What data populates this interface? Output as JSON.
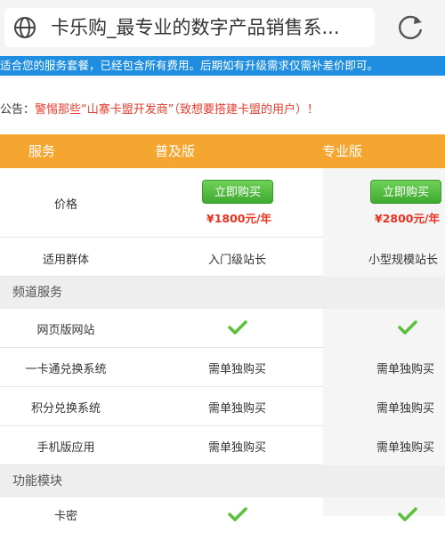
{
  "browser": {
    "url_title": "卡乐购_最专业的数字产品销售系...",
    "globe_icon": "globe-icon",
    "refresh_icon": "refresh-icon"
  },
  "notice": "适合您的服务套餐，已经包含所有费用。后期如有升级需求仅需补差价即可。",
  "announcement": {
    "label": "公告：",
    "message": "警惕那些“山寨卡盟开发商”（致想要搭建卡盟的用户）！"
  },
  "table": {
    "headers": [
      "服务",
      "普及版",
      "专业版"
    ],
    "price_row": {
      "label": "价格",
      "buy_label": "立即购买",
      "price_basic": "¥1800元/年",
      "price_pro": "¥2800元/年"
    },
    "audience_row": {
      "label": "适用群体",
      "basic": "入门级站长",
      "pro": "小型规模站长"
    },
    "sections": [
      {
        "title": "频道服务",
        "rows": [
          {
            "label": "网页版网站",
            "basic": "✔",
            "pro": "✔"
          },
          {
            "label": "一卡通兑换系统",
            "basic": "需单独购买",
            "pro": "需单独购买"
          },
          {
            "label": "积分兑换系统",
            "basic": "需单独购买",
            "pro": "需单独购买"
          },
          {
            "label": "手机版应用",
            "basic": "需单独购买",
            "pro": "需单独购买"
          }
        ]
      },
      {
        "title": "功能模块",
        "rows": [
          {
            "label": "卡密",
            "basic": "✔",
            "pro": "✔"
          }
        ]
      }
    ]
  },
  "colors": {
    "header_orange": "#f5a631",
    "notice_blue": "#1f8ee0",
    "button_green": "#4cb83a",
    "price_red": "#e8321f",
    "check_green": "#5cbf3e"
  }
}
